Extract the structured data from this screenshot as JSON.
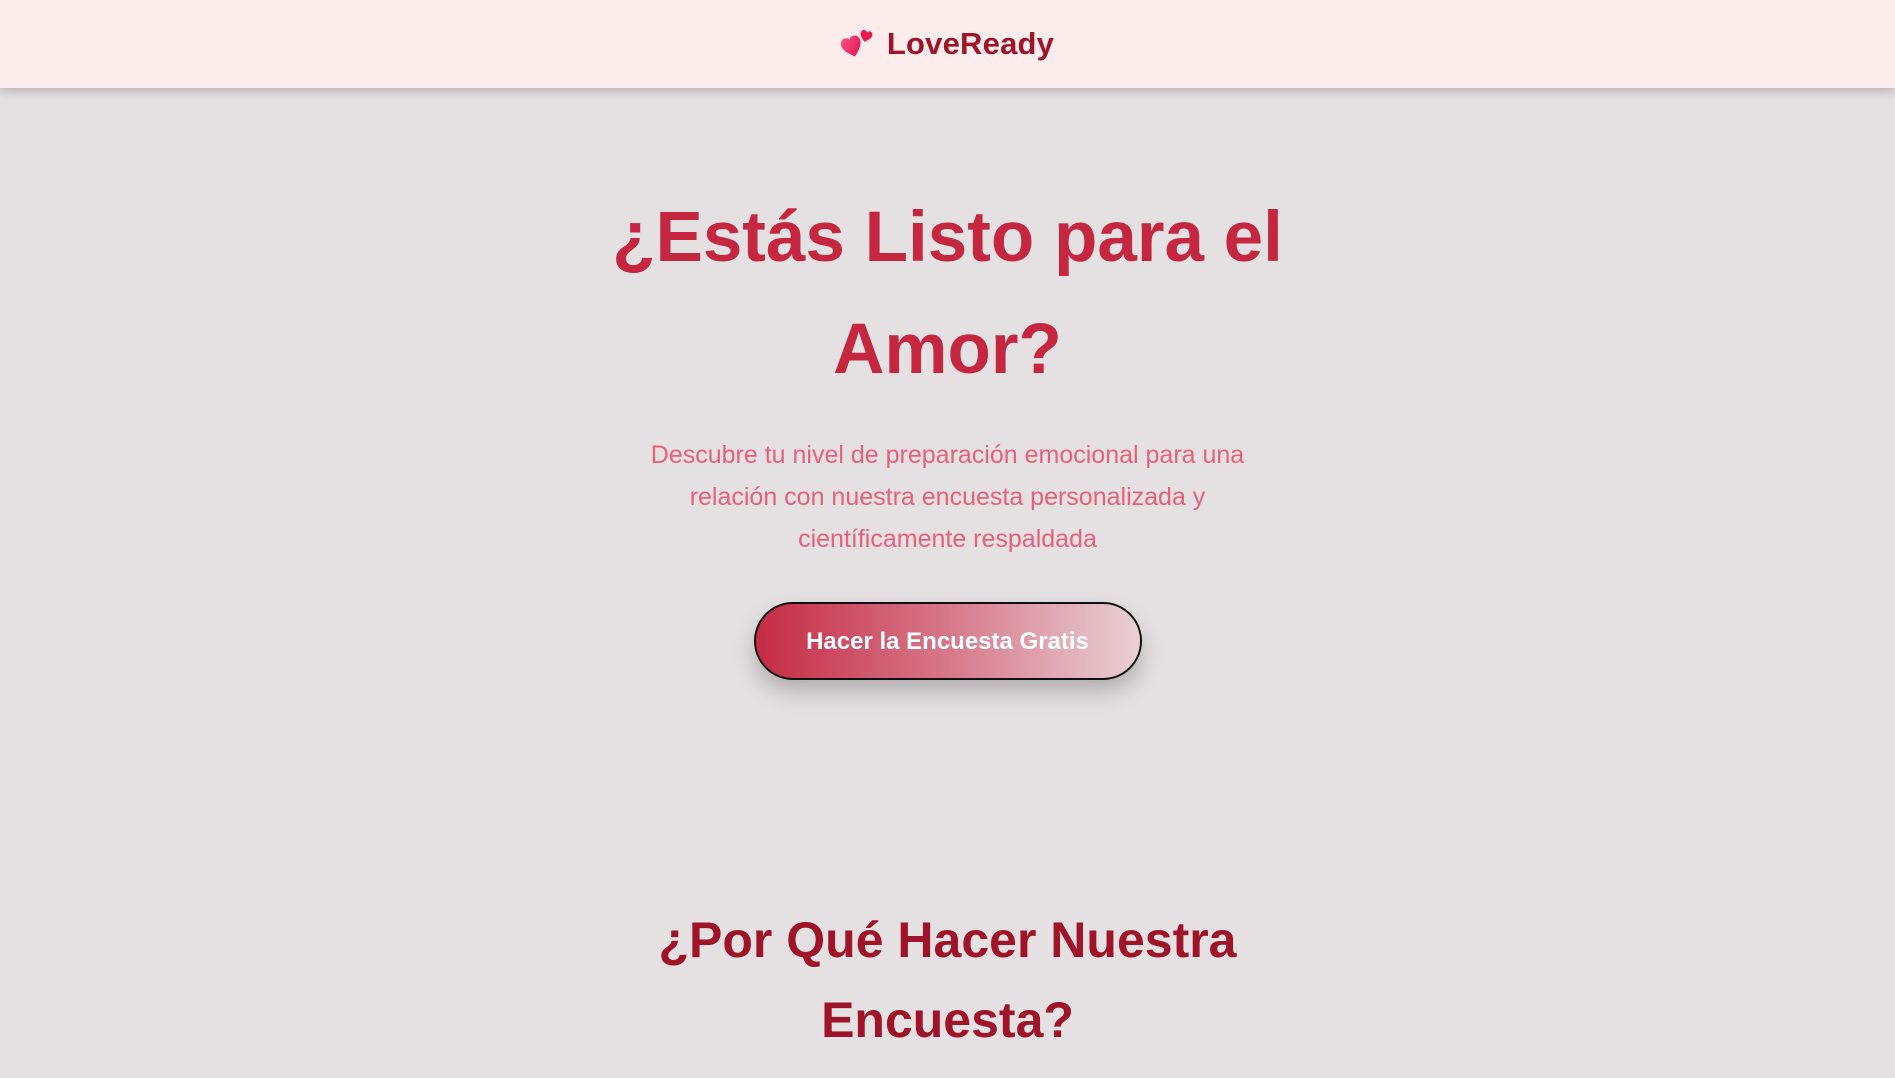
{
  "header": {
    "brand_name": "LoveReady",
    "brand_icon": "two-hearts-icon"
  },
  "hero": {
    "title": "¿Estás Listo para el Amor?",
    "subtitle": "Descubre tu nivel de preparación emocional para una relación con nuestra encuesta personalizada y científicamente respaldada",
    "cta_label": "Hacer la Encuesta Gratis"
  },
  "why_section": {
    "title": "¿Por Qué Hacer Nuestra Encuesta?"
  },
  "colors": {
    "header_bg": "#fdecec",
    "page_bg": "#e5e0e2",
    "brand": "#a0142a",
    "hero_title": "#c4273f",
    "hero_subtitle": "#e8607a",
    "cta_gradient_start": "#c52b44",
    "cta_gradient_end": "#e8d0d4"
  }
}
